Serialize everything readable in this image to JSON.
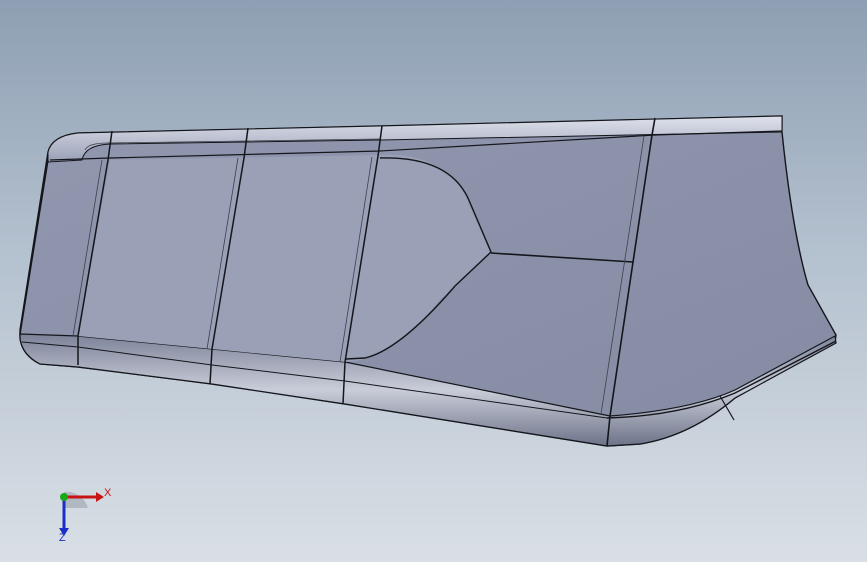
{
  "viewport": {
    "background_top": "#8e9fb3",
    "background_bottom": "#d9dfe5"
  },
  "model": {
    "face_color": "#8a90a8",
    "edge_color": "#15161c",
    "fillet_color": "#c3c8d6"
  },
  "triad": {
    "x_label": "X",
    "z_label": "Z",
    "x_color": "#c81414",
    "y_color": "#18a818",
    "z_color": "#1c2ec8"
  }
}
